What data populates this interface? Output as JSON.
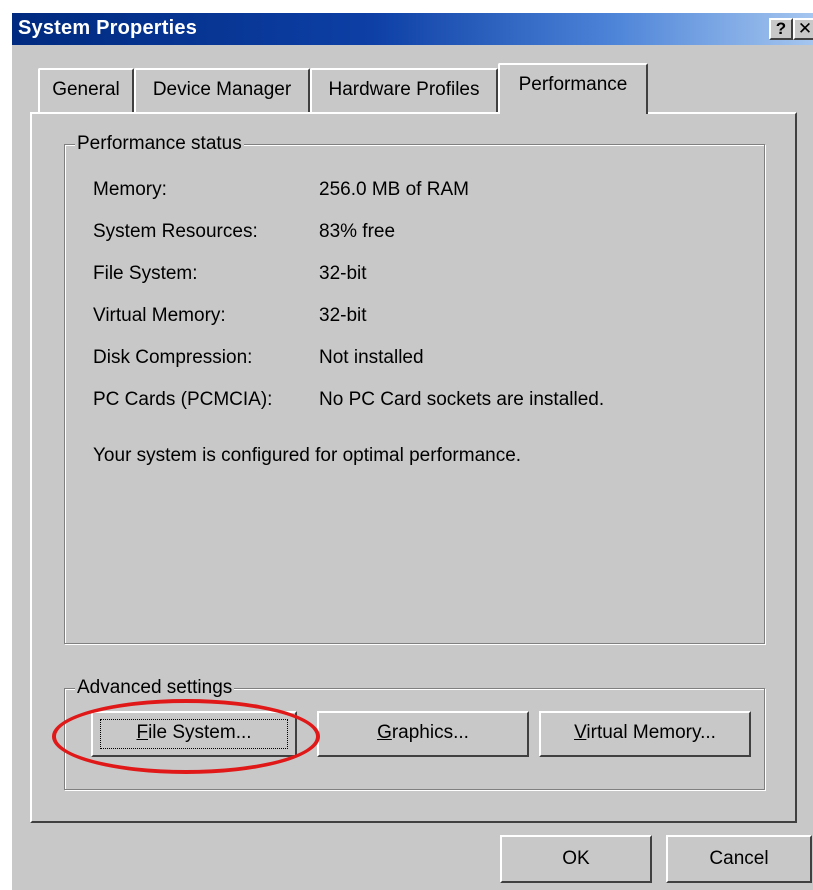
{
  "window": {
    "title": "System Properties",
    "help_label": "?",
    "close_label": "✕"
  },
  "tabs": [
    {
      "label": "General"
    },
    {
      "label": "Device Manager"
    },
    {
      "label": "Hardware Profiles"
    },
    {
      "label": "Performance"
    }
  ],
  "performance_status": {
    "title": "Performance status",
    "rows": [
      {
        "label": "Memory:",
        "value": "256.0 MB of RAM"
      },
      {
        "label": "System Resources:",
        "value": "83% free"
      },
      {
        "label": "File System:",
        "value": "32-bit"
      },
      {
        "label": "Virtual Memory:",
        "value": "32-bit"
      },
      {
        "label": "Disk Compression:",
        "value": "Not installed"
      },
      {
        "label": "PC Cards (PCMCIA):",
        "value": "No PC Card sockets are installed."
      }
    ],
    "summary": "Your system is configured for optimal performance."
  },
  "advanced": {
    "title": "Advanced settings",
    "file_system": {
      "underline": "F",
      "rest": "ile System..."
    },
    "graphics": {
      "underline": "G",
      "rest": "raphics..."
    },
    "virtual_memory": {
      "underline": "V",
      "rest": "irtual Memory..."
    }
  },
  "footer": {
    "ok": "OK",
    "cancel": "Cancel"
  },
  "colors": {
    "annotation": "#e01818",
    "titlebar": "#0d3fa5"
  }
}
